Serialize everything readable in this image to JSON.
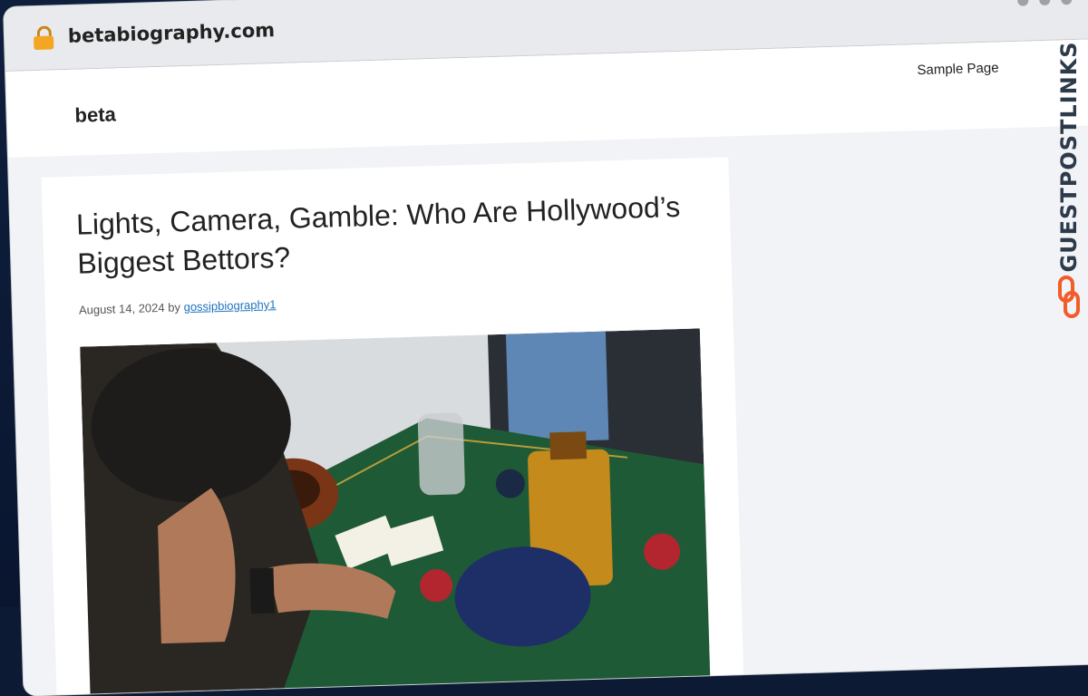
{
  "browser": {
    "url": "betabiography.com",
    "lock_icon": "lock-icon",
    "window_controls": [
      "window-dot",
      "window-dot",
      "window-dot"
    ]
  },
  "site": {
    "title": "beta",
    "nav": {
      "sample_page": "Sample Page"
    }
  },
  "article": {
    "title": "Lights, Camera, Gamble: Who Are Hollywood’s Biggest Bettors?",
    "date": "August 14, 2024",
    "by": "by",
    "author": "gossipbiography1",
    "image_subject": "man at a green casino table with playing cards, poker chips, whiskey bottle, glasses and ashtray"
  },
  "watermark": {
    "text": "GUESTPOSTLINKS",
    "icon": "chain-link-icon",
    "accent_color": "#f25c2a"
  },
  "colors": {
    "background": "#0c1a33",
    "link": "#1e73be",
    "table_felt": "#1f5a36"
  }
}
